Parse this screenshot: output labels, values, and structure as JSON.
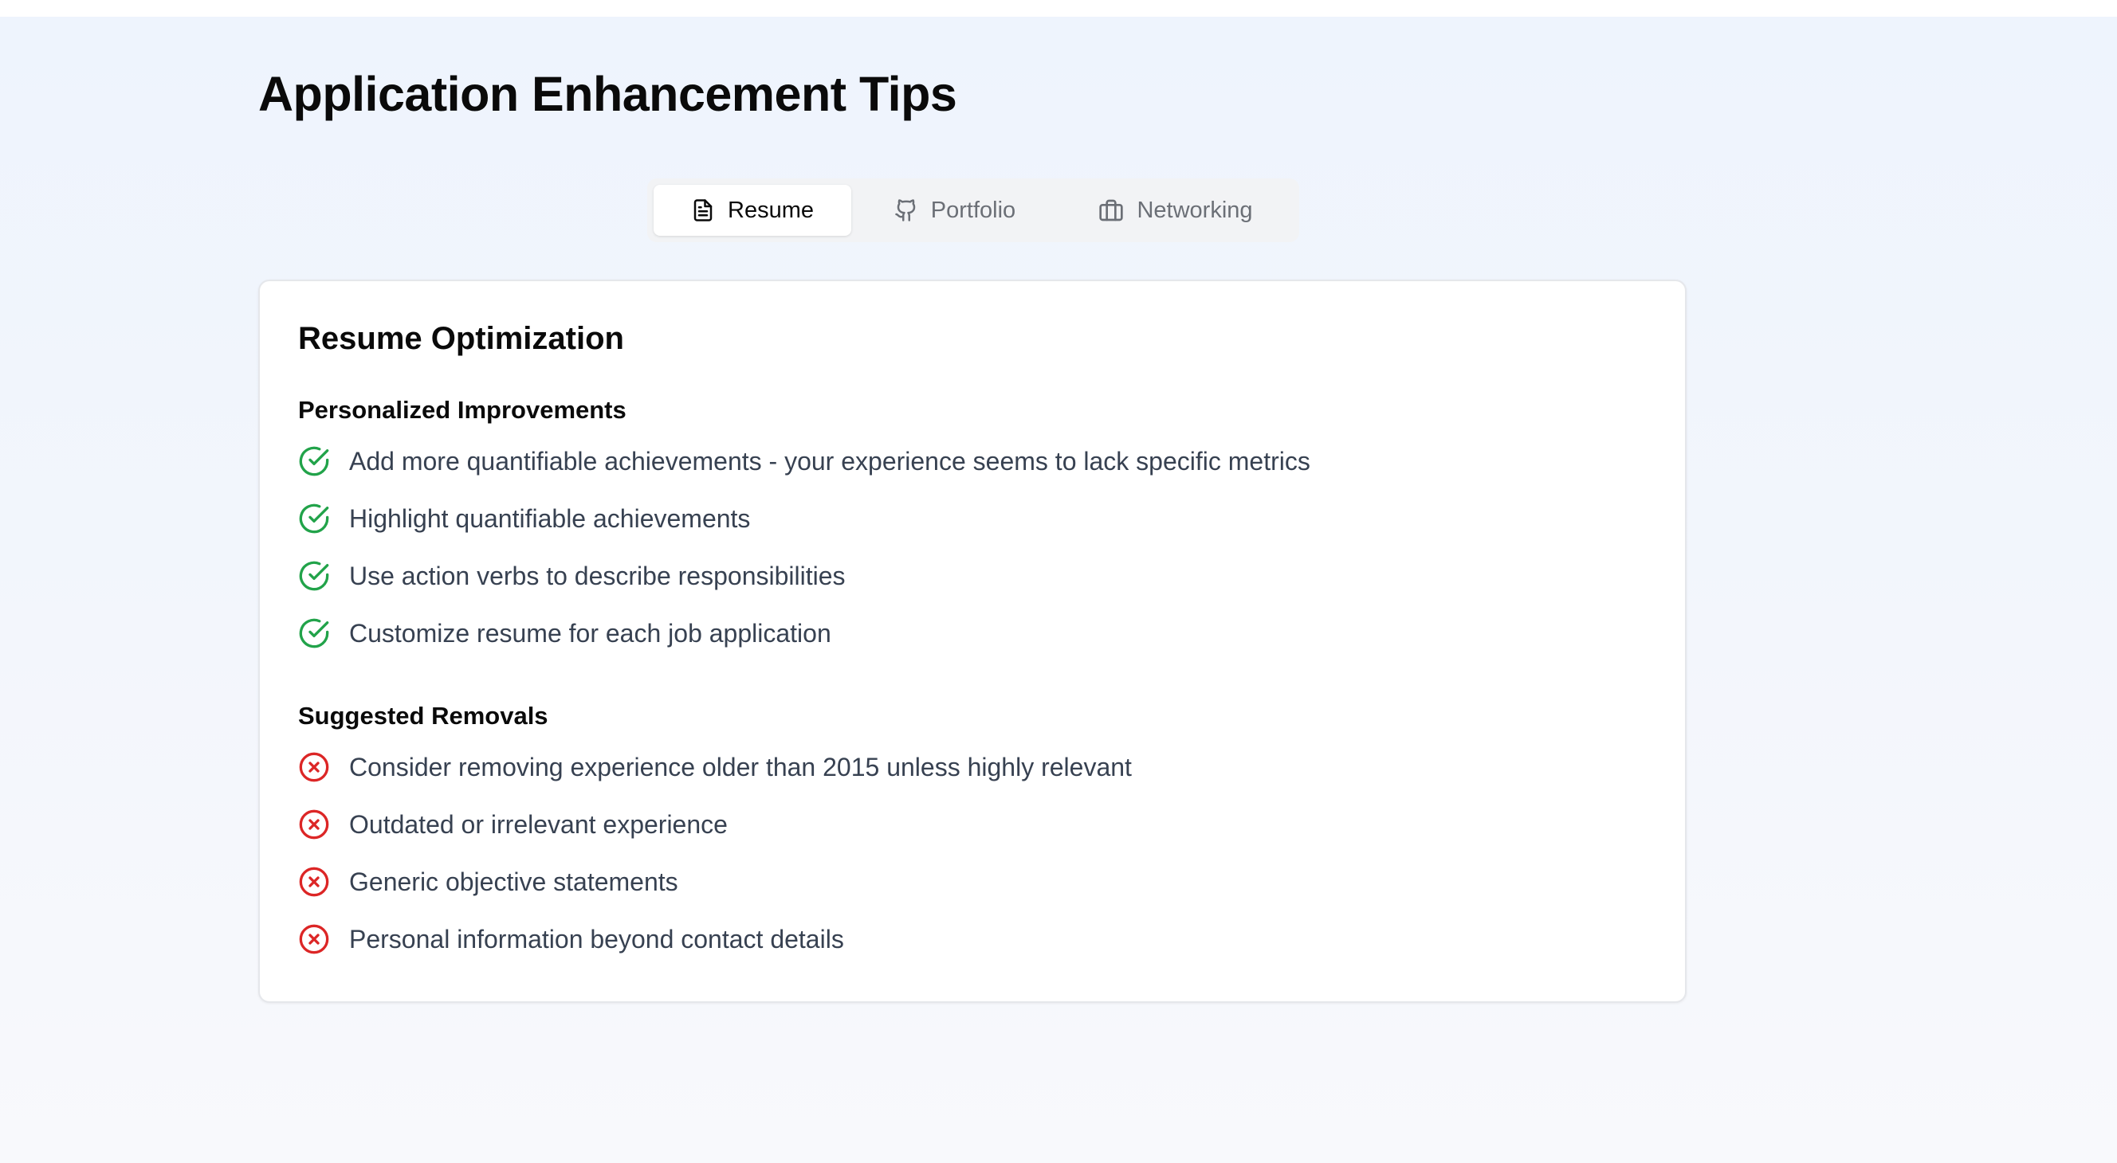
{
  "page": {
    "title": "Application Enhancement Tips"
  },
  "tabs": [
    {
      "label": "Resume",
      "icon": "file-text-icon",
      "active": true
    },
    {
      "label": "Portfolio",
      "icon": "github-icon",
      "active": false
    },
    {
      "label": "Networking",
      "icon": "briefcase-icon",
      "active": false
    }
  ],
  "card": {
    "title": "Resume Optimization",
    "improvements": {
      "heading": "Personalized Improvements",
      "icon": "check-circle-icon",
      "color": "#22a34a",
      "items": [
        "Add more quantifiable achievements - your experience seems to lack specific metrics",
        "Highlight quantifiable achievements",
        "Use action verbs to describe responsibilities",
        "Customize resume for each job application"
      ]
    },
    "removals": {
      "heading": "Suggested Removals",
      "icon": "x-circle-icon",
      "color": "#dc2626",
      "items": [
        "Consider removing experience older than 2015 unless highly relevant",
        "Outdated or irrelevant experience",
        "Generic objective statements",
        "Personal information beyond contact details"
      ]
    }
  }
}
